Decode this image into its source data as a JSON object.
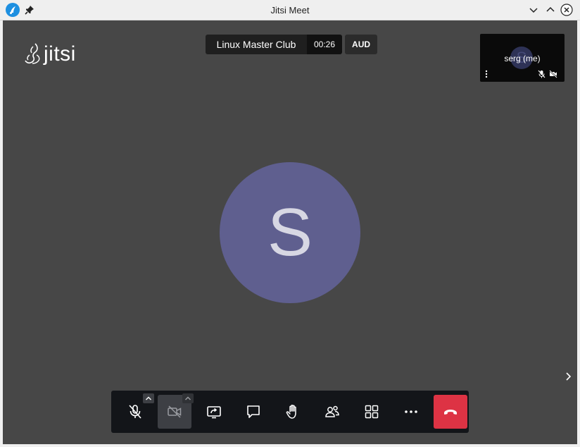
{
  "window": {
    "title": "Jitsi Meet",
    "icons": {
      "app": "jitsi-app-icon",
      "pin": "pin-icon",
      "minimize": "chevron-down-icon",
      "maximize": "chevron-up-icon",
      "close": "close-icon"
    }
  },
  "logo": {
    "text": "jitsi",
    "icon": "jitsi-logo-icon"
  },
  "meeting": {
    "subject": "Linux Master Club",
    "timer": "00:26",
    "badge": "AUD"
  },
  "local_participant": {
    "name": "serg (me)",
    "avatar_initial": "S",
    "audio_muted": true,
    "video_muted": true
  },
  "main_participant": {
    "avatar_initial": "S",
    "avatar_color": "#5f5f8f"
  },
  "toolbar": {
    "buttons": [
      {
        "name": "microphone",
        "icon": "microphone-muted-icon",
        "has_options": true
      },
      {
        "name": "camera",
        "icon": "camera-off-icon",
        "has_options": true,
        "active": true
      },
      {
        "name": "share-screen",
        "icon": "share-screen-icon"
      },
      {
        "name": "chat",
        "icon": "chat-icon"
      },
      {
        "name": "raise-hand",
        "icon": "raise-hand-icon"
      },
      {
        "name": "participants",
        "icon": "participants-icon"
      },
      {
        "name": "tile-view",
        "icon": "tile-view-icon"
      },
      {
        "name": "more",
        "icon": "more-icon"
      },
      {
        "name": "hang-up",
        "icon": "hangup-icon",
        "color": "#dd3344"
      }
    ]
  },
  "colors": {
    "stage_background": "#474747",
    "toolbar_background": "#131519",
    "hangup": "#dd3344",
    "avatar": "#5f5f8f"
  }
}
